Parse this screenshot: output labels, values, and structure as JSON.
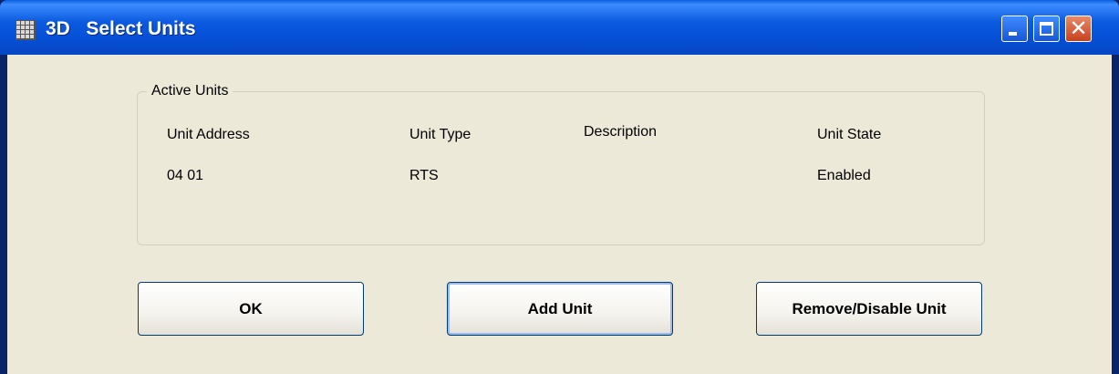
{
  "window": {
    "title": "3D   Select Units",
    "controls": {
      "minimize": "minimize-icon",
      "maximize": "maximize-icon",
      "close": "close-icon"
    }
  },
  "group": {
    "legend": "Active Units",
    "columns": [
      "Unit Address",
      "Unit Type",
      "Description",
      "Unit State"
    ],
    "rows": [
      [
        "04 01",
        "RTS",
        "",
        "Enabled"
      ]
    ]
  },
  "buttons": {
    "ok": "OK",
    "add": "Add Unit",
    "remove": "Remove/Disable Unit"
  },
  "colors": {
    "titlebar": "#0550D6",
    "dialog_bg": "#ECE9D8",
    "close_button": "#C7411C"
  }
}
